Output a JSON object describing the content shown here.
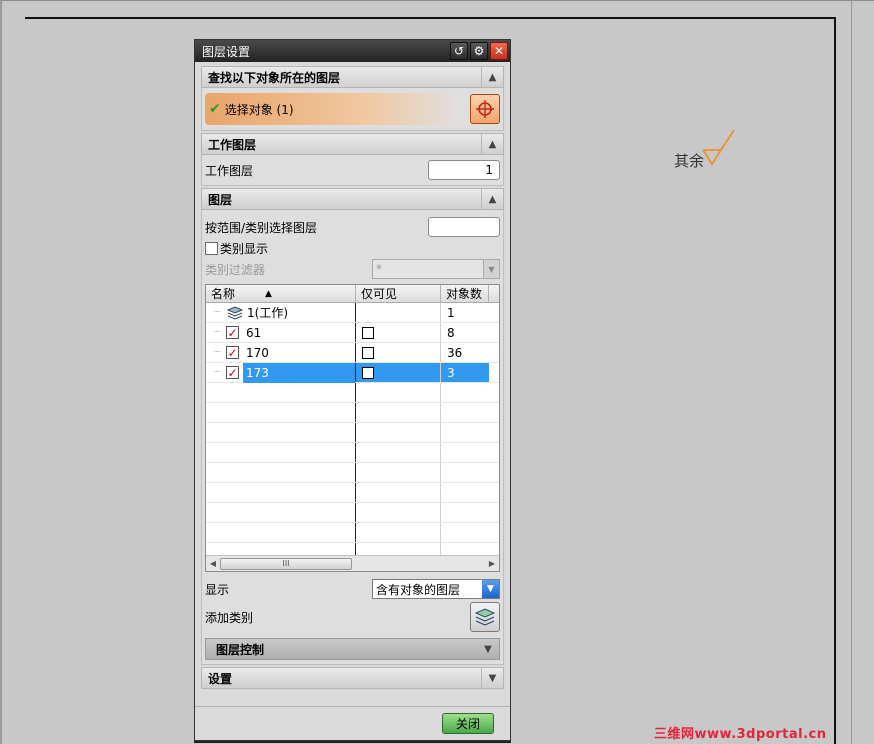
{
  "canvas": {
    "annotation_text": "其余",
    "watermark": "三维网www.3dportal.cn"
  },
  "dialog": {
    "title": "图层设置",
    "titlebar_icons": [
      "reset-icon",
      "gear-icon",
      "close-icon"
    ],
    "find_section": {
      "header": "查找以下对象所在的图层",
      "select_label": "选择对象 (1)"
    },
    "work_layer_section": {
      "header": "工作图层",
      "label": "工作图层",
      "value": "1"
    },
    "layer_section": {
      "header": "图层",
      "range_label": "按范围/类别选择图层",
      "range_value": "",
      "category_display_label": "类别显示",
      "category_filter_label": "类别过滤器",
      "category_filter_value": "*",
      "table": {
        "columns": [
          "名称",
          "仅可见",
          "对象数"
        ],
        "rows": [
          {
            "name": "1(工作)",
            "visible_only": "",
            "count": "1",
            "type": "work"
          },
          {
            "name": "61",
            "visible_only": "",
            "count": "8",
            "type": "layer"
          },
          {
            "name": "170",
            "visible_only": "",
            "count": "36",
            "type": "layer"
          },
          {
            "name": "173",
            "visible_only": "",
            "count": "3",
            "type": "layer",
            "selected": true
          }
        ],
        "scroll_thumb": "III"
      },
      "display_label": "显示",
      "display_value": "含有对象的图层",
      "add_category_label": "添加类别",
      "layer_control_header": "图层控制"
    },
    "settings_section": {
      "header": "设置"
    },
    "close_button": "关闭"
  }
}
